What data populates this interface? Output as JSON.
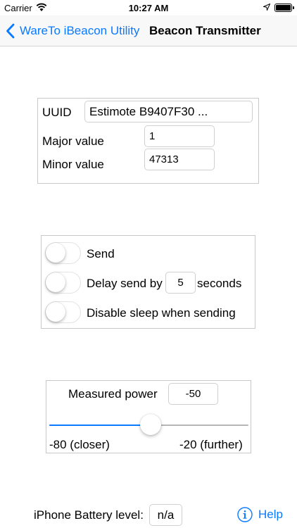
{
  "status_bar": {
    "carrier": "Carrier",
    "time": "10:27 AM"
  },
  "nav": {
    "back_label": "WareTo iBeacon Utility",
    "title": "Beacon Transmitter"
  },
  "beacon": {
    "uuid_label": "UUID",
    "uuid_value": "Estimote B9407F30 ...",
    "major_label": "Major value",
    "major_value": "1",
    "minor_label": "Minor value",
    "minor_value": "47313"
  },
  "options": {
    "send_label": "Send",
    "send_on": false,
    "delay_label": "Delay send by",
    "delay_value": "5",
    "delay_unit": "seconds",
    "delay_on": false,
    "sleep_label": "Disable sleep when sending",
    "sleep_on": false
  },
  "power": {
    "label": "Measured power",
    "value": "-50",
    "slider_min": -80,
    "slider_max": -20,
    "slider_value": -50,
    "min_label": "-80 (closer)",
    "max_label": "-20 (further)"
  },
  "footer": {
    "battery_label": "iPhone Battery level:",
    "battery_value": "n/a",
    "help_label": "Help"
  },
  "colors": {
    "accent": "#0a7aff"
  }
}
